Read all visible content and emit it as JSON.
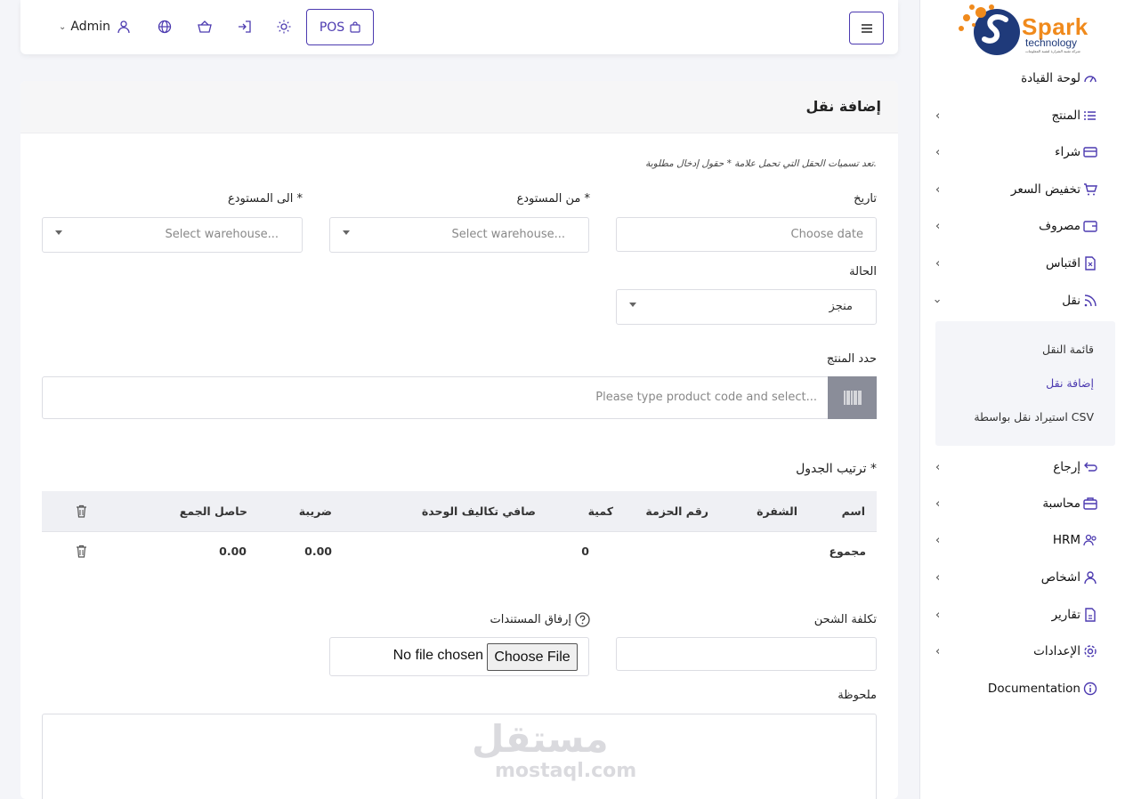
{
  "brand": {
    "name": "Spark",
    "sub": "technology",
    "tagline": "شركة تقنية الشرارة لتقنية المعلومات"
  },
  "sidebar": {
    "items": [
      {
        "label": "لوحة القيادة",
        "icon": "dashboard-icon"
      },
      {
        "label": "المنتج",
        "icon": "list-icon"
      },
      {
        "label": "شراء",
        "icon": "credit-card-icon"
      },
      {
        "label": "تخفيض السعر",
        "icon": "cart-icon"
      },
      {
        "label": "مصروف",
        "icon": "wallet-icon"
      },
      {
        "label": "اقتباس",
        "icon": "file-x-icon"
      },
      {
        "label": "نقل",
        "icon": "rss-icon"
      },
      {
        "label": "إرجاع",
        "icon": "return-icon"
      },
      {
        "label": "محاسبة",
        "icon": "briefcase-icon"
      },
      {
        "label": "HRM",
        "icon": "users-icon"
      },
      {
        "label": "اشخاص",
        "icon": "user-icon"
      },
      {
        "label": "تقارير",
        "icon": "report-icon"
      },
      {
        "label": "الإعدادات",
        "icon": "gear-icon"
      },
      {
        "label": "Documentation",
        "icon": "info-icon"
      }
    ],
    "submenu": [
      "قائمة النقل",
      "إضافة نقل",
      "استيراد نقل بواسطة CSV"
    ]
  },
  "topbar": {
    "pos_label": "POS",
    "user_label": "Admin"
  },
  "page": {
    "title": "إضافة نقل",
    "required_note": "تعد تسميات الحقل التي تحمل علامة * حقول إدخال مطلوبة.",
    "date_label": "تاريخ",
    "date_placeholder": "Choose date",
    "from_label": "من المستودع *",
    "from_placeholder": "Select warehouse...",
    "to_label": "الى المستودع *",
    "to_placeholder": "Select warehouse...",
    "status_label": "الحالة",
    "status_value": "منجز",
    "product_label": "حدد المنتج",
    "product_placeholder": "Please type product code and select...",
    "table_label": "ترتيب الجدول *",
    "columns": [
      "اسم",
      "الشفرة",
      "رقم الحزمة",
      "كمية",
      "صافي تكاليف الوحدة",
      "ضريبة",
      "حاصل الجمع"
    ],
    "totals": {
      "label": "مجموع",
      "qty": "0",
      "tax": "0.00",
      "total": "0.00"
    },
    "shipping_label": "تكلفة الشحن",
    "attach_label": "إرفاق المستندات",
    "file_button": "Choose File",
    "file_status": "No file chosen",
    "note_label": "ملحوظة"
  },
  "watermark": {
    "ar": "مستقل",
    "en": "mostaql.com"
  },
  "colors": {
    "accent": "#4c3ab0",
    "brand_orange": "#f08a1c",
    "brand_blue": "#1f3a7a"
  }
}
